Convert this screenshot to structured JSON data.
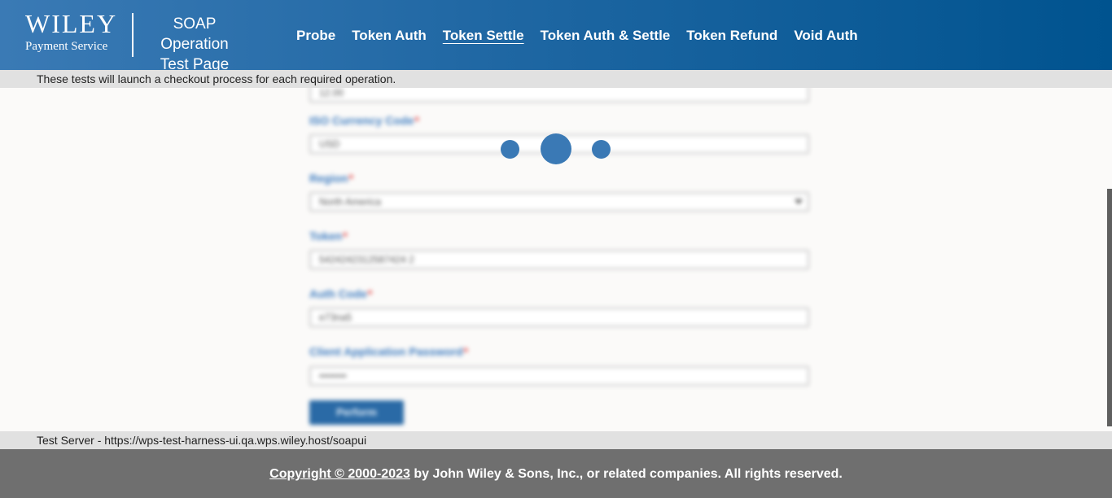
{
  "header": {
    "logo_wordmark": "WILEY",
    "logo_subtitle": "Payment Service",
    "title_line1": "SOAP Operation",
    "title_line2": "Test Page",
    "nav": [
      {
        "label": "Probe",
        "active": false
      },
      {
        "label": "Token Auth",
        "active": false
      },
      {
        "label": "Token Settle",
        "active": true
      },
      {
        "label": "Token Auth & Settle",
        "active": false
      },
      {
        "label": "Token Refund",
        "active": false
      },
      {
        "label": "Void Auth",
        "active": false
      }
    ],
    "gradient_start": "#3a7ab5",
    "gradient_end": "#00538f"
  },
  "info_bar": {
    "text": "These tests will launch a checkout process for each required operation."
  },
  "form": {
    "amount_value": "12.00",
    "currency": {
      "label": "ISO Currency Code",
      "value": "USD"
    },
    "region": {
      "label": "Region",
      "value": "North America"
    },
    "token": {
      "label": "Token",
      "value": "5424242312587424 2"
    },
    "auth_code": {
      "label": "Auth Code",
      "value": "e73na5"
    },
    "password": {
      "label": "Client Application Password",
      "value": "••••••••"
    },
    "required_marker": "*",
    "perform_label": "Perform"
  },
  "loading": {
    "icon": "loading-dots-icon",
    "color": "#3a79b5"
  },
  "server_bar": {
    "text": "Test Server - https://wps-test-harness-ui.qa.wps.wiley.host/soapui"
  },
  "footer": {
    "copyright_link": "Copyright © 2000-2023",
    "copyright_rest": " by John Wiley & Sons, Inc., or related companies. All rights reserved."
  },
  "colors": {
    "label_blue": "#3d7cc0",
    "required_red": "#e23a3a",
    "footer_gray": "#6f6f6f",
    "bar_gray": "#e1e1e1"
  }
}
